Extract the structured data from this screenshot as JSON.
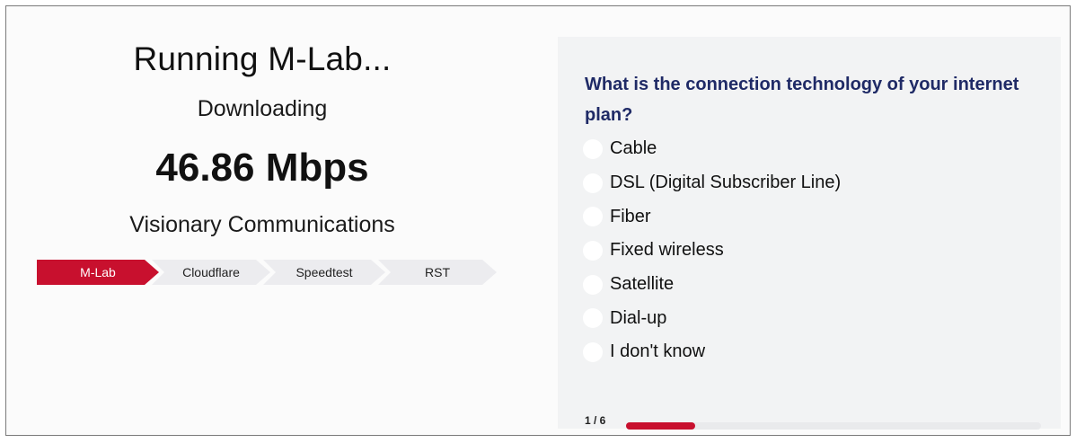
{
  "status": {
    "title": "Running M-Lab...",
    "phase": "Downloading",
    "speed": "46.86 Mbps",
    "provider": "Visionary Communications"
  },
  "steps": [
    {
      "label": "M-Lab",
      "active": true
    },
    {
      "label": "Cloudflare",
      "active": false
    },
    {
      "label": "Speedtest",
      "active": false
    },
    {
      "label": "RST",
      "active": false
    }
  ],
  "survey": {
    "question": "What is the connection technology of your internet plan?",
    "options": [
      "Cable",
      "DSL (Digital Subscriber Line)",
      "Fiber",
      "Fixed wireless",
      "Satellite",
      "Dial-up",
      "I don't know"
    ],
    "pager": "1 / 6",
    "progress": 0.1667
  },
  "colors": {
    "accent": "#c8102e",
    "question_text": "#1f2a66",
    "step_inactive": "#ececef"
  }
}
